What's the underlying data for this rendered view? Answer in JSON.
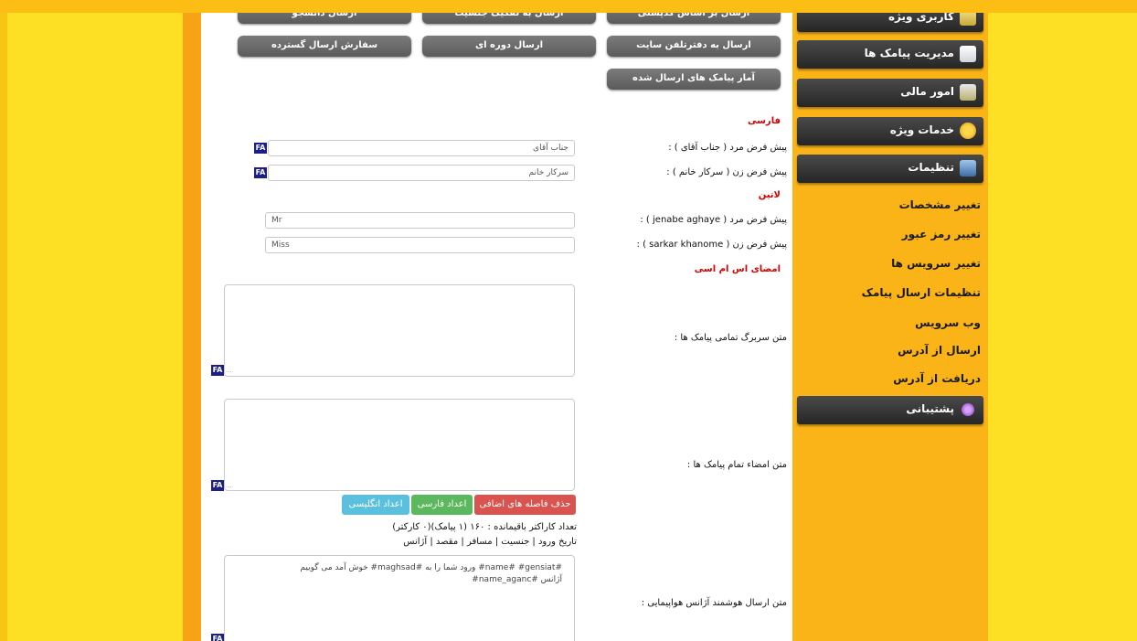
{
  "top_buttons_row1": [
    "ارسال دانشجو",
    "ارسال به تفکیک جنسیت",
    "ارسال بر اساس کدپستی"
  ],
  "top_buttons_row2": [
    "سفارش ارسال گسترده",
    "ارسال دوره ای",
    "ارسال به دفترتلفن سایت"
  ],
  "top_button_row3": "آمار پیامک های ارسال شده",
  "sections": {
    "farsi": "فارسی",
    "latin": "لاتین",
    "signature": "امضای اس ام اسی"
  },
  "fields": {
    "farsi_male_label": "پیش فرض مرد ( جناب آقای ) :",
    "farsi_male_value": "جناب آقای",
    "farsi_female_label": "پیش فرض زن ( سرکار خانم ) :",
    "farsi_female_value": "سرکار خانم",
    "latin_male_label": "پیش فرض مرد ( jenabe aghaye ) :",
    "latin_male_value": "Mr",
    "latin_female_label": "پیش فرض زن ( sarkar khanome ) :",
    "latin_female_value": "Miss",
    "header_text_label": "متن سربرگ تمامی پیامک ها :",
    "footer_text_label": "متن امضاء تمام پیامک ها :",
    "agency_text_label": "متن ارسال هوشمند آژانس هواپیمایی :",
    "agency_text_line1": "#name# #gensiat# ورود شما را به #maghsad# خوش آمد می گوییم",
    "agency_text_line2": "آژانس #name_aganc#"
  },
  "fa_badge": "FA",
  "grip": "...",
  "actions": {
    "remove_spaces": "حذف فاصله های اضافی",
    "persian_digits": "اعداد فارسی",
    "english_digits": "اعداد انگلیسی"
  },
  "char_count": "تعداد کاراکتر باقیمانده : ۱۶۰ (۱ پیامک)(۰ کارکتر)",
  "variables": "تاریخ ورود | جنسیت | مسافر | مقصد | آژانس",
  "menu": {
    "special_user": "کاربری ویژه",
    "sms_manage": "مدیریت پیامک ها",
    "finance": "امور مالی",
    "special_services": "خدمات ویژه",
    "settings": "تنظیمات",
    "support": "پشتیبانی"
  },
  "settings_links": [
    "تغییر مشخصات",
    "تغییر رمز عبور",
    "تغییر سرویس ها",
    "تنظیمات ارسال پیامک",
    "وب سرویس",
    "ارسال از آدرس",
    "دریافت از آدرس"
  ],
  "colors": {
    "remove_spaces": "#d9534f",
    "persian_digits": "#5cb85c",
    "english_digits": "#5bc0de",
    "section_heading": "#d40000"
  }
}
